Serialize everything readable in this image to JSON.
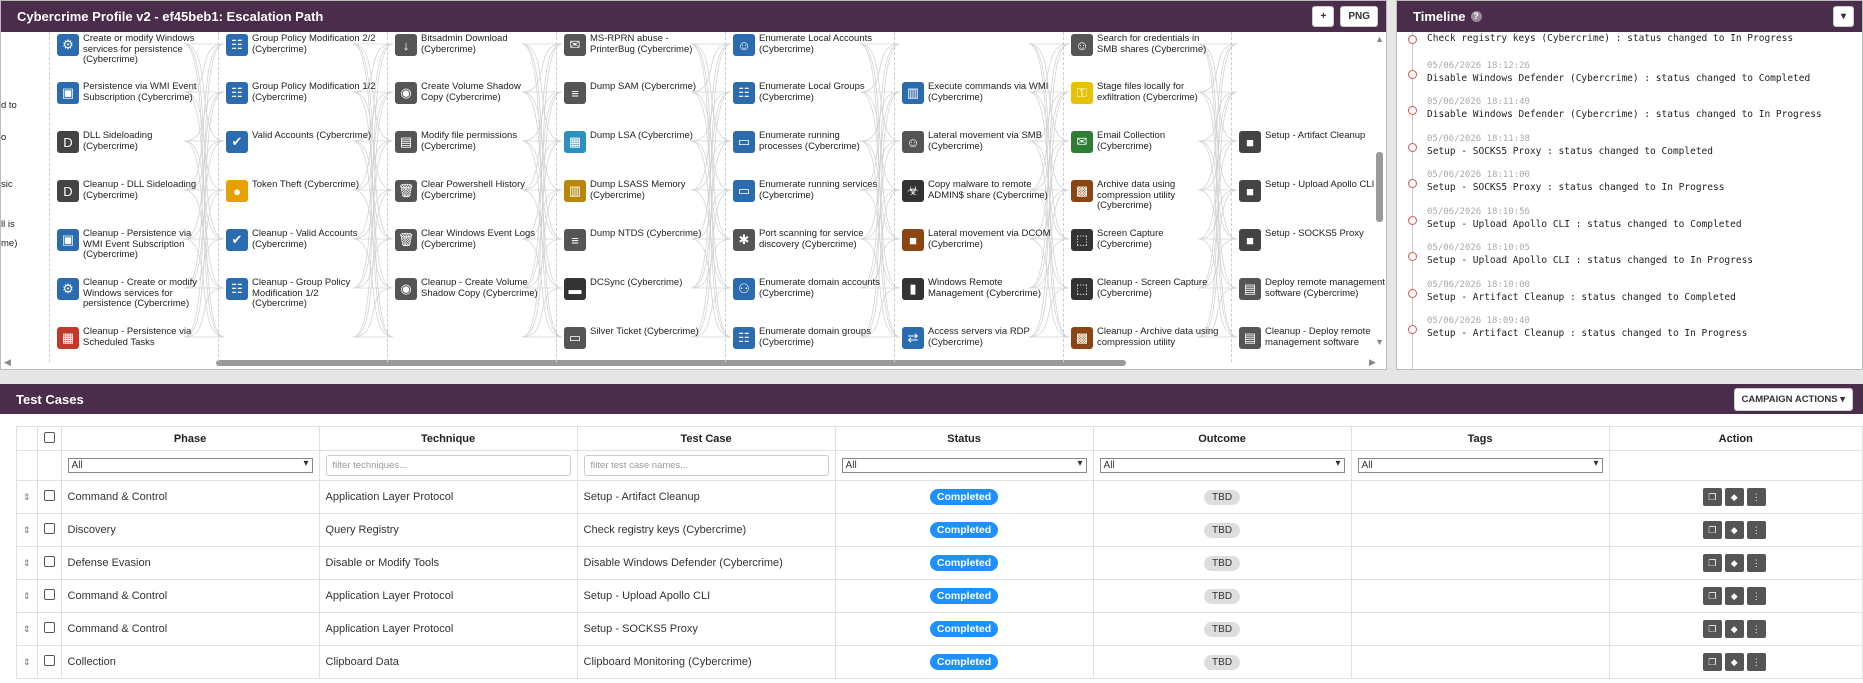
{
  "escalation": {
    "title": "Cybercrime Profile v2 - ef45beb1: Escalation Path",
    "plus_label": "+",
    "png_label": "PNG",
    "edge_labels": [
      "d to",
      "o",
      "sic",
      "ll is",
      "me)"
    ],
    "nodes": [
      {
        "label": "Create or modify Windows services for persistence (Cybercrime)",
        "icon": "windows-service-icon",
        "color": "#2b6cb0"
      },
      {
        "label": "Persistence via WMI Event Subscription (Cybercrime)",
        "icon": "wmi-icon",
        "color": "#2b6cb0"
      },
      {
        "label": "DLL Sideloading (Cybercrime)",
        "icon": "dll-icon",
        "color": "#444"
      },
      {
        "label": "Cleanup - DLL Sideloading (Cybercrime)",
        "icon": "dll-icon",
        "color": "#444"
      },
      {
        "label": "Cleanup - Persistence via WMI Event Subscription (Cybercrime)",
        "icon": "wmi-icon",
        "color": "#2b6cb0"
      },
      {
        "label": "Cleanup - Create or modify Windows services for persistence (Cybercrime)",
        "icon": "windows-service-icon",
        "color": "#2b6cb0"
      },
      {
        "label": "Cleanup - Persistence via Scheduled Tasks",
        "icon": "calendar-icon",
        "color": "#c0392b"
      },
      {
        "label": "Group Policy Modification 2/2 (Cybercrime)",
        "icon": "group-icon",
        "color": "#2b6cb0"
      },
      {
        "label": "Group Policy Modification 1/2 (Cybercrime)",
        "icon": "group-icon",
        "color": "#2b6cb0"
      },
      {
        "label": "Valid Accounts (Cybercrime)",
        "icon": "user-check-icon",
        "color": "#2b6cb0"
      },
      {
        "label": "Token Theft (Cybercrime)",
        "icon": "token-icon",
        "color": "#e6a100"
      },
      {
        "label": "Cleanup - Valid Accounts (Cybercrime)",
        "icon": "user-check-icon",
        "color": "#2b6cb0"
      },
      {
        "label": "Cleanup - Group Policy Modification 1/2 (Cybercrime)",
        "icon": "group-icon",
        "color": "#2b6cb0"
      },
      {
        "label": "Bitsadmin Download (Cybercrime)",
        "icon": "download-icon",
        "color": "#555"
      },
      {
        "label": "Create Volume Shadow Copy (Cybercrime)",
        "icon": "eye-doc-icon",
        "color": "#555"
      },
      {
        "label": "Modify file permissions (Cybercrime)",
        "icon": "file-perm-icon",
        "color": "#555"
      },
      {
        "label": "Clear Powershell History (Cybercrime)",
        "icon": "trash-icon",
        "color": "#555"
      },
      {
        "label": "Clear Windows Event Logs (Cybercrime)",
        "icon": "trash-icon",
        "color": "#555"
      },
      {
        "label": "Cleanup - Create Volume Shadow Copy (Cybercrime)",
        "icon": "eye-doc-icon",
        "color": "#555"
      },
      {
        "label": "MS-RPRN abuse - PrinterBug (Cybercrime)",
        "icon": "mail-icon",
        "color": "#555"
      },
      {
        "label": "Dump SAM (Cybercrime)",
        "icon": "database-icon",
        "color": "#555"
      },
      {
        "label": "Dump LSA (Cybercrime)",
        "icon": "blocks-icon",
        "color": "#2b8fbf"
      },
      {
        "label": "Dump LSASS Memory (Cybercrime)",
        "icon": "memory-icon",
        "color": "#b8860b"
      },
      {
        "label": "Dump NTDS (Cybercrime)",
        "icon": "database-icon",
        "color": "#555"
      },
      {
        "label": "DCSync (Cybercrime)",
        "icon": "server-icon",
        "color": "#333"
      },
      {
        "label": "Silver Ticket (Cybercrime)",
        "icon": "ticket-icon",
        "color": "#555"
      },
      {
        "label": "Enumerate Local Accounts (Cybercrime)",
        "icon": "user-lock-icon",
        "color": "#2b6cb0"
      },
      {
        "label": "Enumerate Local Groups (Cybercrime)",
        "icon": "group-icon",
        "color": "#2b6cb0"
      },
      {
        "label": "Enumerate running processes (Cybercrime)",
        "icon": "monitor-icon",
        "color": "#2b6cb0"
      },
      {
        "label": "Enumerate running services (Cybercrime)",
        "icon": "monitor-icon",
        "color": "#2b6cb0"
      },
      {
        "label": "Port scanning for service discovery (Cybercrime)",
        "icon": "bug-icon",
        "color": "#555"
      },
      {
        "label": "Enumerate domain accounts (Cybercrime)",
        "icon": "network-icon",
        "color": "#2b6cb0"
      },
      {
        "label": "Enumerate domain groups (Cybercrime)",
        "icon": "group-icon",
        "color": "#2b6cb0"
      },
      {
        "label": "Execute commands via WMI (Cybercrime)",
        "icon": "chart-monitor-icon",
        "color": "#2b6cb0"
      },
      {
        "label": "Lateral movement via SMB (Cybercrime)",
        "icon": "user-lock-icon",
        "color": "#555"
      },
      {
        "label": "Copy malware to remote ADMIN$ share (Cybercrime)",
        "icon": "malware-icon",
        "color": "#333"
      },
      {
        "label": "Lateral movement via DCOM (Cybercrime)",
        "icon": "box-icon",
        "color": "#8b4513"
      },
      {
        "label": "Windows Remote Management (Cybercrime)",
        "icon": "phone-icon",
        "color": "#333"
      },
      {
        "label": "Access servers via RDP (Cybercrime)",
        "icon": "rdp-icon",
        "color": "#2b6cb0"
      },
      {
        "label": "Search for credentials in SMB shares (Cybercrime)",
        "icon": "user-lock-icon",
        "color": "#555"
      },
      {
        "label": "Stage files locally for exfiltration (Cybercrime)",
        "icon": "key-icon",
        "color": "#e6c200"
      },
      {
        "label": "Email Collection (Cybercrime)",
        "icon": "mail-icon",
        "color": "#2e7d32"
      },
      {
        "label": "Archive data using compression utility (Cybercrime)",
        "icon": "archive-icon",
        "color": "#8b4513"
      },
      {
        "label": "Screen Capture (Cybercrime)",
        "icon": "capture-icon",
        "color": "#333"
      },
      {
        "label": "Cleanup - Screen Capture (Cybercrime)",
        "icon": "capture-icon",
        "color": "#333"
      },
      {
        "label": "Cleanup - Archive data using compression utility",
        "icon": "archive-icon",
        "color": "#8b4513"
      },
      {
        "label": "Setup - Artifact Cleanup",
        "icon": "setup-icon",
        "color": "#444"
      },
      {
        "label": "Setup - Upload Apollo CLI",
        "icon": "setup-icon",
        "color": "#444"
      },
      {
        "label": "Setup - SOCKS5 Proxy",
        "icon": "setup-icon",
        "color": "#444"
      },
      {
        "label": "Deploy remote management software (Cybercrime)",
        "icon": "doc-gear-icon",
        "color": "#555"
      },
      {
        "label": "Cleanup - Deploy remote management software",
        "icon": "doc-gear-icon",
        "color": "#555"
      }
    ]
  },
  "timeline": {
    "title": "Timeline",
    "help": "?",
    "menu": "▾",
    "entries": [
      {
        "ts": "",
        "text": "Check registry keys (Cybercrime) : status changed to In Progress"
      },
      {
        "ts": "05/06/2026 18:12:26",
        "text": "Disable Windows Defender (Cybercrime) : status changed to Completed"
      },
      {
        "ts": "05/06/2026 18:11:40",
        "text": "Disable Windows Defender (Cybercrime) : status changed to In Progress"
      },
      {
        "ts": "05/06/2026 18:11:38",
        "text": "Setup - SOCKS5 Proxy : status changed to Completed"
      },
      {
        "ts": "05/06/2026 18:11:00",
        "text": "Setup - SOCKS5 Proxy : status changed to In Progress"
      },
      {
        "ts": "05/06/2026 18:10:56",
        "text": "Setup - Upload Apollo CLI : status changed to Completed"
      },
      {
        "ts": "05/06/2026 18:10:05",
        "text": "Setup - Upload Apollo CLI : status changed to In Progress"
      },
      {
        "ts": "05/06/2026 18:10:00",
        "text": "Setup - Artifact Cleanup : status changed to Completed"
      },
      {
        "ts": "05/06/2026 18:09:40",
        "text": "Setup - Artifact Cleanup : status changed to In Progress"
      }
    ]
  },
  "test_cases": {
    "title": "Test Cases",
    "campaign_actions": "CAMPAIGN ACTIONS ▾",
    "columns": [
      "Phase",
      "Technique",
      "Test Case",
      "Status",
      "Outcome",
      "Tags",
      "Action"
    ],
    "filters": {
      "phase": "All",
      "technique_placeholder": "filter techniques...",
      "testcase_placeholder": "filter test case names...",
      "status": "All",
      "outcome": "All",
      "tags": "All"
    },
    "rows": [
      {
        "phase": "Command & Control",
        "technique": "Application Layer Protocol",
        "test_case": "Setup - Artifact Cleanup",
        "status": "Completed",
        "outcome": "TBD"
      },
      {
        "phase": "Discovery",
        "technique": "Query Registry",
        "test_case": "Check registry keys (Cybercrime)",
        "status": "Completed",
        "outcome": "TBD"
      },
      {
        "phase": "Defense Evasion",
        "technique": "Disable or Modify Tools",
        "test_case": "Disable Windows Defender (Cybercrime)",
        "status": "Completed",
        "outcome": "TBD"
      },
      {
        "phase": "Command & Control",
        "technique": "Application Layer Protocol",
        "test_case": "Setup - Upload Apollo CLI",
        "status": "Completed",
        "outcome": "TBD"
      },
      {
        "phase": "Command & Control",
        "technique": "Application Layer Protocol",
        "test_case": "Setup - SOCKS5 Proxy",
        "status": "Completed",
        "outcome": "TBD"
      },
      {
        "phase": "Collection",
        "technique": "Clipboard Data",
        "test_case": "Clipboard Monitoring (Cybercrime)",
        "status": "Completed",
        "outcome": "TBD"
      }
    ]
  },
  "colors": {
    "header": "#4a2c4b",
    "completed": "#1e90ff",
    "timeline_dot": "#d9534f"
  }
}
